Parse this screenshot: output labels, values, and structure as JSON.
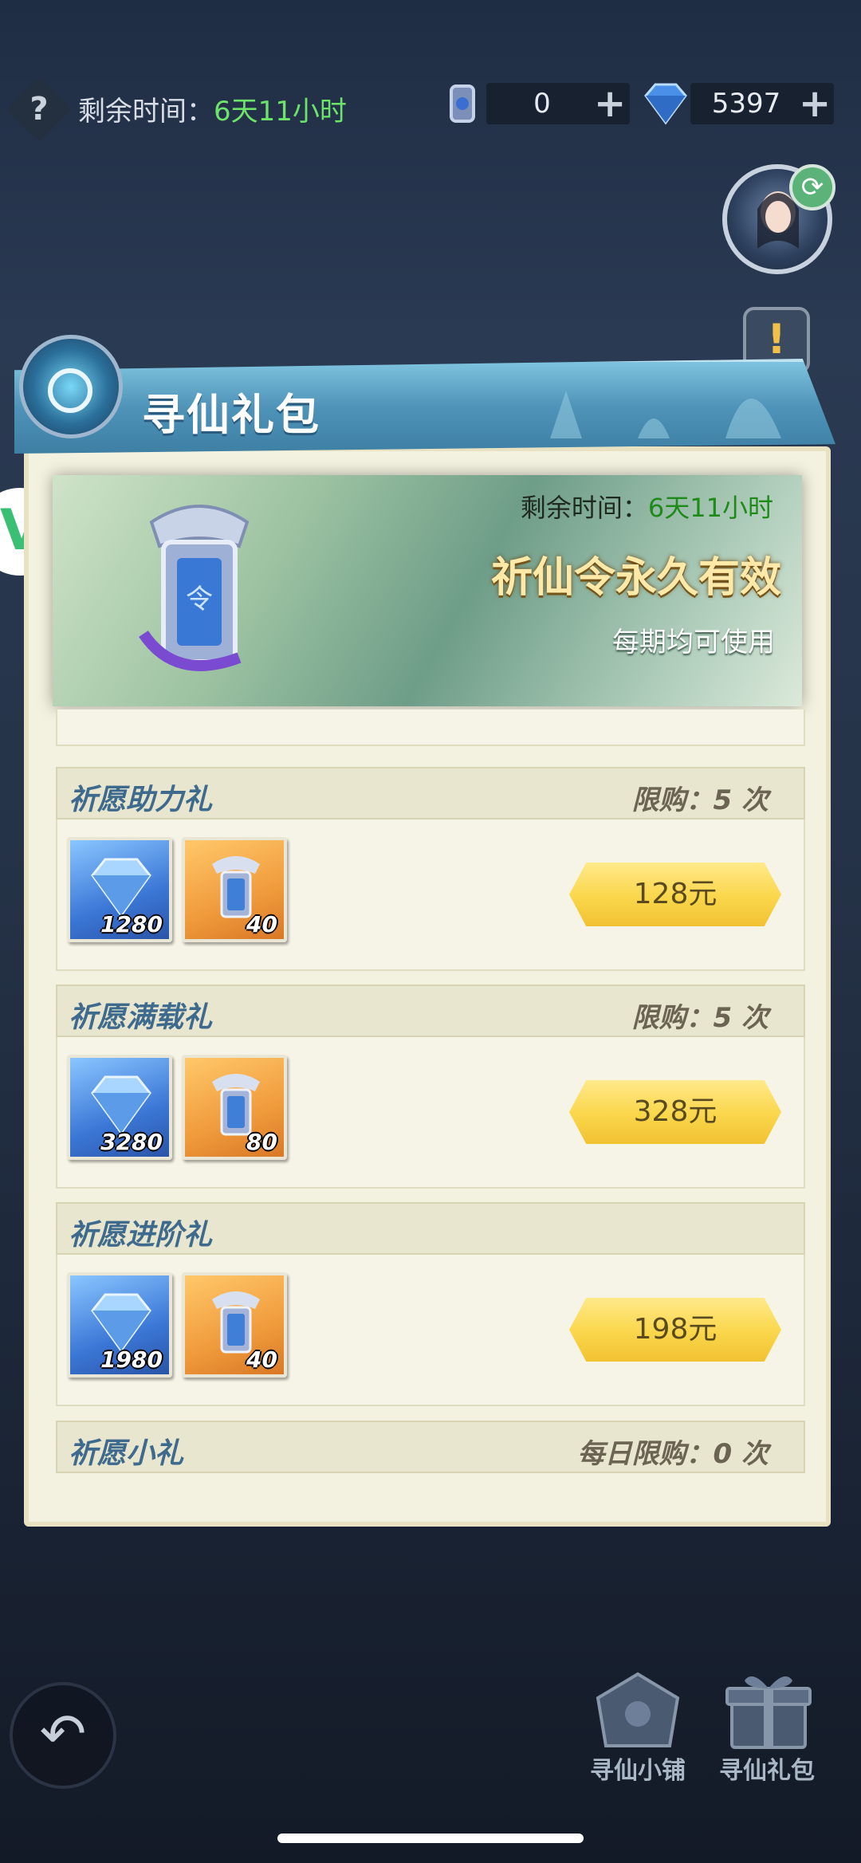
{
  "top_bar": {
    "remain_label": "剩余时间：",
    "remain_value": "6天11小时",
    "currency_token_amount": "0",
    "currency_diamond_amount": "5397"
  },
  "panel": {
    "title": "寻仙礼包",
    "hero": {
      "remain_label": "剩余时间：",
      "remain_value": "6天11小时",
      "headline": "祈仙令永久有效",
      "subline": "每期均可使用"
    }
  },
  "packs": [
    {
      "name": "祈愿助力礼",
      "limit": "限购：5 次",
      "items": [
        {
          "icon": "diamond-icon",
          "qty": "1280"
        },
        {
          "icon": "prayer-token-icon",
          "qty": "40"
        }
      ],
      "price": "128元"
    },
    {
      "name": "祈愿满载礼",
      "limit": "限购：5 次",
      "items": [
        {
          "icon": "diamond-icon",
          "qty": "3280"
        },
        {
          "icon": "prayer-token-icon",
          "qty": "80"
        }
      ],
      "price": "328元"
    },
    {
      "name": "祈愿进阶礼",
      "limit": "",
      "items": [
        {
          "icon": "diamond-icon",
          "qty": "1980"
        },
        {
          "icon": "prayer-token-icon",
          "qty": "40"
        }
      ],
      "price": "198元"
    },
    {
      "name": "祈愿小礼",
      "limit": "每日限购：0 次"
    }
  ],
  "bottom_nav": {
    "shop_label": "寻仙小铺",
    "gift_label": "寻仙礼包"
  },
  "colors": {
    "accent_green": "#6ee36a",
    "price_button": "#fad64a",
    "pack_title": "#3e6a8e"
  }
}
